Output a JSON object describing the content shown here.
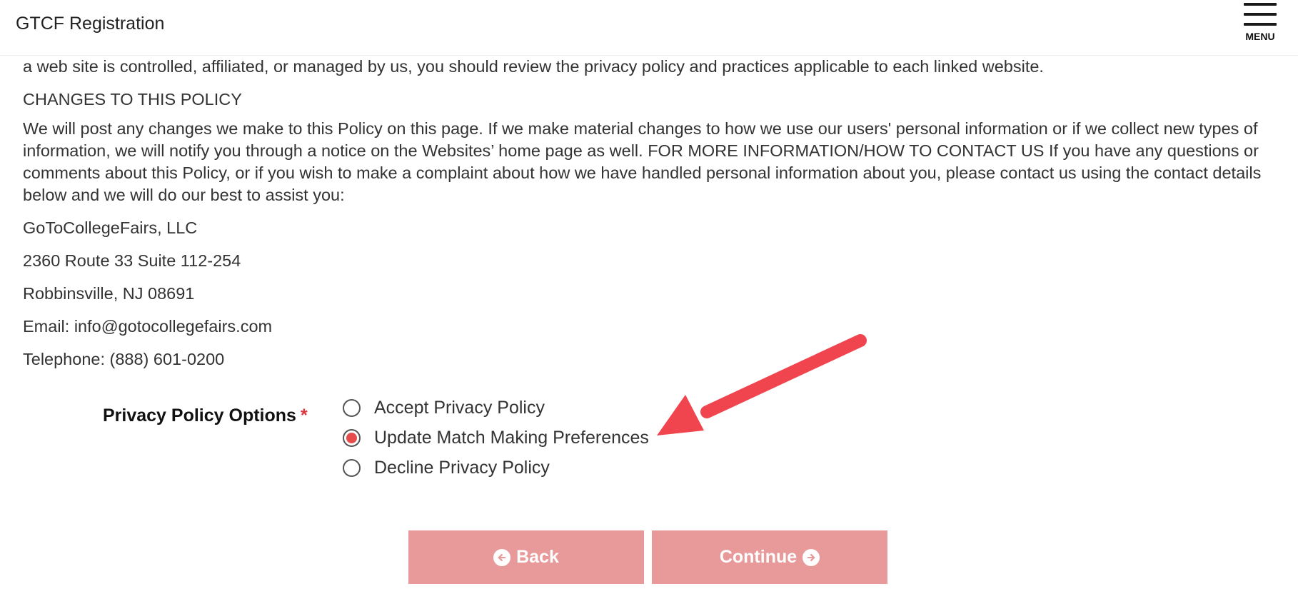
{
  "header": {
    "title": "GTCF Registration",
    "menu_label": "MENU"
  },
  "policy_text": {
    "paragraph_linked_sites": "a web site is controlled, affiliated, or managed by us, you should review the privacy policy and practices applicable to each linked website.",
    "changes_heading": "CHANGES TO THIS POLICY",
    "changes_body": "We will post any changes we make to this Policy on this page. If we make material changes to how we use our users' personal information or if we collect new types of information, we will notify you through a notice on the Websites’ home page as well. FOR MORE INFORMATION/HOW TO CONTACT US If you have any questions or comments about this Policy, or if you wish to make a complaint about how we have handled personal information about you, please contact us using the contact details below and we will do our best to assist you:",
    "company": "GoToCollegeFairs, LLC",
    "address_line1": "2360 Route 33 Suite 112-254",
    "address_line2": "Robbinsville, NJ 08691",
    "email": "Email: info@gotocollegefairs.com",
    "telephone": "Telephone: (888) 601-0200"
  },
  "privacy_options": {
    "label": "Privacy Policy Options",
    "required_marker": "*",
    "options": [
      {
        "label": "Accept Privacy Policy",
        "selected": false
      },
      {
        "label": "Update Match Making Preferences",
        "selected": true
      },
      {
        "label": "Decline Privacy Policy",
        "selected": false
      }
    ]
  },
  "buttons": {
    "back_label": "Back",
    "continue_label": "Continue",
    "back_icon": "arrow-circle-left-icon",
    "continue_icon": "arrow-circle-right-icon"
  },
  "colors": {
    "button_bg": "#e89a9b",
    "radio_selected": "#e74c4c",
    "required": "#d9363e",
    "annotation_arrow": "#f0454e"
  }
}
